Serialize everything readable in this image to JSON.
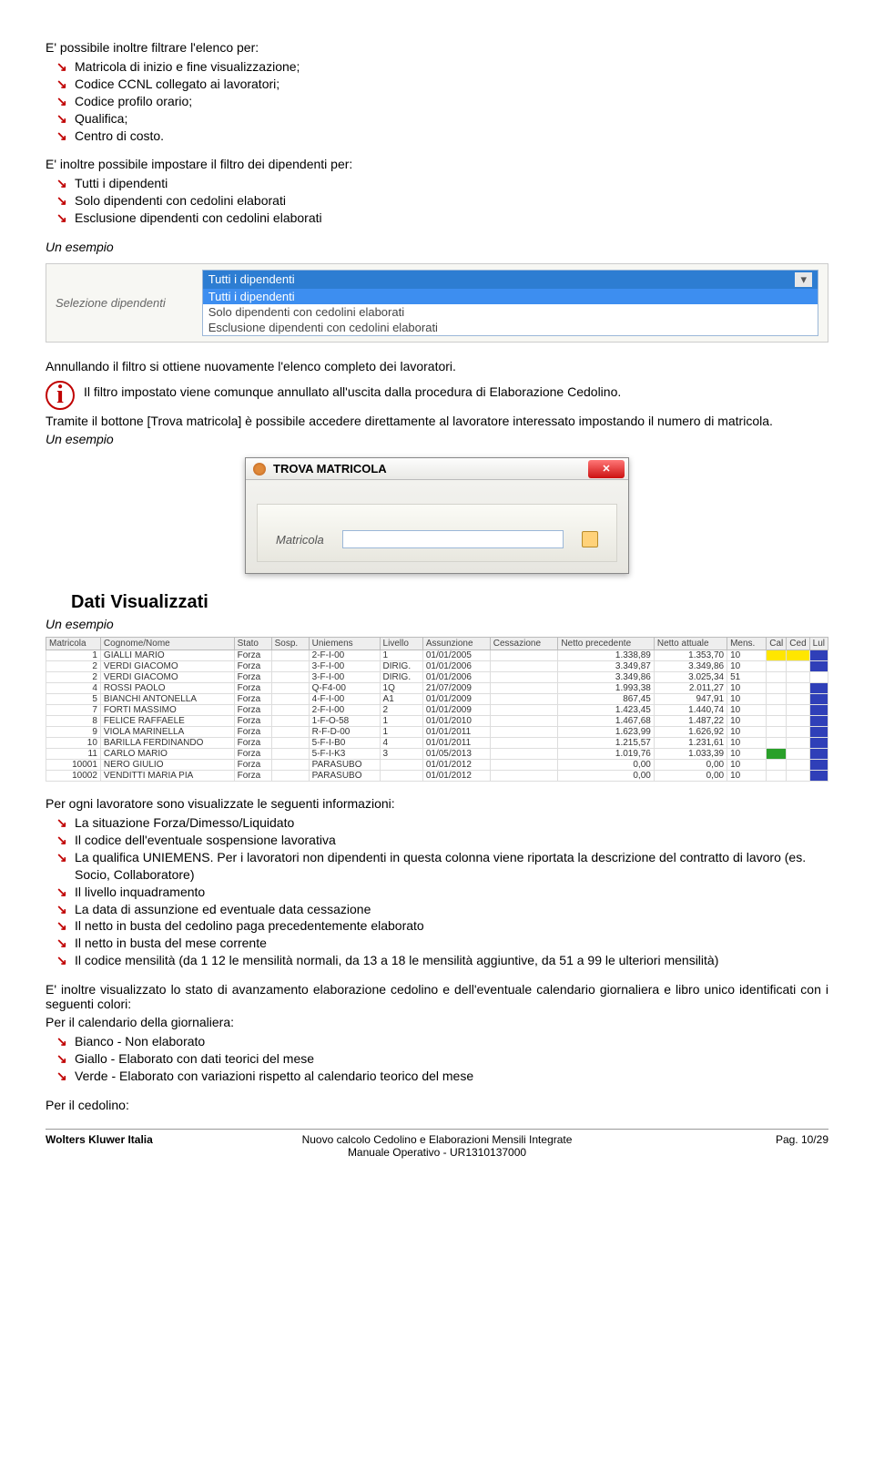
{
  "intro_line": "E' possibile inoltre filtrare l'elenco per:",
  "filters1": [
    "Matricola di inizio e fine visualizzazione;",
    "Codice CCNL collegato ai lavoratori;",
    "Codice profilo orario;",
    "Qualifica;",
    "Centro di costo."
  ],
  "intro_line2": "E' inoltre possibile impostare il filtro dei dipendenti per:",
  "filters2": [
    "Tutti i dipendenti",
    "Solo dipendenti con cedolini elaborati",
    "Esclusione dipendenti con cedolini elaborati"
  ],
  "un_esempio": "Un esempio",
  "dropdown": {
    "label": "Selezione dipendenti",
    "selected": "Tutti i dipendenti",
    "options": [
      "Tutti i dipendenti",
      "Solo dipendenti con cedolini elaborati",
      "Esclusione dipendenti con cedolini elaborati"
    ]
  },
  "annullando": "Annullando il filtro si ottiene nuovamente l'elenco completo dei lavoratori.",
  "info_text": "Il filtro impostato viene comunque annullato all'uscita dalla procedura di Elaborazione Cedolino.",
  "tramite": "Tramite il bottone [Trova matricola] è possibile accedere direttamente al lavoratore interessato impostando il numero di matricola.",
  "trova": {
    "title": "TROVA MATRICOLA",
    "label": "Matricola"
  },
  "dati_heading": "Dati Visualizzati",
  "table": {
    "headers": [
      "Matricola",
      "Cognome/Nome",
      "Stato",
      "Sosp.",
      "Uniemens",
      "Livello",
      "Assunzione",
      "Cessazione",
      "Netto precedente",
      "Netto attuale",
      "Mens.",
      "Cal",
      "Ced",
      "Lul"
    ],
    "rows": [
      {
        "id": "1",
        "name": "GIALLI MARIO",
        "stato": "Forza",
        "sosp": "",
        "uni": "2-F-I-00",
        "liv": "1",
        "ass": "01/01/2005",
        "cess": "",
        "np": "1.338,89",
        "na": "1.353,70",
        "mens": "10",
        "cal": "yellow",
        "ced": "yellow",
        "lul": "blue"
      },
      {
        "id": "2",
        "name": "VERDI GIACOMO",
        "stato": "Forza",
        "sosp": "",
        "uni": "3-F-I-00",
        "liv": "DIRIG.",
        "ass": "01/01/2006",
        "cess": "",
        "np": "3.349,87",
        "na": "3.349,86",
        "mens": "10",
        "cal": "",
        "ced": "",
        "lul": "blue"
      },
      {
        "id": "2",
        "name": "VERDI GIACOMO",
        "stato": "Forza",
        "sosp": "",
        "uni": "3-F-I-00",
        "liv": "DIRIG.",
        "ass": "01/01/2006",
        "cess": "",
        "np": "3.349,86",
        "na": "3.025,34",
        "mens": "51",
        "cal": "",
        "ced": "",
        "lul": ""
      },
      {
        "id": "4",
        "name": "ROSSI PAOLO",
        "stato": "Forza",
        "sosp": "",
        "uni": "Q-F4-00",
        "liv": "1Q",
        "ass": "21/07/2009",
        "cess": "",
        "np": "1.993,38",
        "na": "2.011,27",
        "mens": "10",
        "cal": "",
        "ced": "",
        "lul": "blue"
      },
      {
        "id": "5",
        "name": "BIANCHI ANTONELLA",
        "stato": "Forza",
        "sosp": "",
        "uni": "4-F-I-00",
        "liv": "A1",
        "ass": "01/01/2009",
        "cess": "",
        "np": "867,45",
        "na": "947,91",
        "mens": "10",
        "cal": "",
        "ced": "",
        "lul": "blue"
      },
      {
        "id": "7",
        "name": "FORTI MASSIMO",
        "stato": "Forza",
        "sosp": "",
        "uni": "2-F-I-00",
        "liv": "2",
        "ass": "01/01/2009",
        "cess": "",
        "np": "1.423,45",
        "na": "1.440,74",
        "mens": "10",
        "cal": "",
        "ced": "",
        "lul": "blue"
      },
      {
        "id": "8",
        "name": "FELICE RAFFAELE",
        "stato": "Forza",
        "sosp": "",
        "uni": "1-F-O-58",
        "liv": "1",
        "ass": "01/01/2010",
        "cess": "",
        "np": "1.467,68",
        "na": "1.487,22",
        "mens": "10",
        "cal": "",
        "ced": "",
        "lul": "blue"
      },
      {
        "id": "9",
        "name": "VIOLA MARINELLA",
        "stato": "Forza",
        "sosp": "",
        "uni": "R-F-D-00",
        "liv": "1",
        "ass": "01/01/2011",
        "cess": "",
        "np": "1.623,99",
        "na": "1.626,92",
        "mens": "10",
        "cal": "",
        "ced": "",
        "lul": "blue"
      },
      {
        "id": "10",
        "name": "BARILLA FERDINANDO",
        "stato": "Forza",
        "sosp": "",
        "uni": "5-F-I-B0",
        "liv": "4",
        "ass": "01/01/2011",
        "cess": "",
        "np": "1.215,57",
        "na": "1.231,61",
        "mens": "10",
        "cal": "",
        "ced": "",
        "lul": "blue"
      },
      {
        "id": "11",
        "name": "CARLO MARIO",
        "stato": "Forza",
        "sosp": "",
        "uni": "5-F-I-K3",
        "liv": "3",
        "ass": "01/05/2013",
        "cess": "",
        "np": "1.019,76",
        "na": "1.033,39",
        "mens": "10",
        "cal": "green",
        "ced": "",
        "lul": "blue"
      },
      {
        "id": "10001",
        "name": "NERO GIULIO",
        "stato": "Forza",
        "sosp": "",
        "uni": "PARASUBO",
        "liv": "",
        "ass": "01/01/2012",
        "cess": "",
        "np": "0,00",
        "na": "0,00",
        "mens": "10",
        "cal": "",
        "ced": "",
        "lul": "blue"
      },
      {
        "id": "10002",
        "name": "VENDITTI MARIA PIA",
        "stato": "Forza",
        "sosp": "",
        "uni": "PARASUBO",
        "liv": "",
        "ass": "01/01/2012",
        "cess": "",
        "np": "0,00",
        "na": "0,00",
        "mens": "10",
        "cal": "",
        "ced": "",
        "lul": "blue"
      }
    ]
  },
  "perogni": "Per ogni lavoratore sono visualizzate le seguenti informazioni:",
  "infolist": [
    "La situazione Forza/Dimesso/Liquidato",
    "Il codice dell'eventuale sospensione lavorativa",
    "La qualifica UNIEMENS. Per i lavoratori non dipendenti in questa colonna viene riportata la descrizione del contratto di lavoro (es. Socio, Collaboratore)",
    "Il livello inquadramento",
    "La data di assunzione ed eventuale data cessazione",
    "Il netto in busta del cedolino paga precedentemente elaborato",
    "Il netto in busta del mese corrente",
    "Il codice mensilità (da 1 12 le mensilità normali, da 13 a 18 le mensilità aggiuntive, da 51 a 99 le ulteriori mensilità)"
  ],
  "einoltre": "E' inoltre visualizzato lo stato di avanzamento elaborazione cedolino e dell'eventuale calendario giornaliera e libro unico identificati con i seguenti colori:",
  "cal_heading": "Per il calendario della giornaliera:",
  "cal_list": [
    "Bianco - Non elaborato",
    "Giallo - Elaborato con dati teorici del mese",
    "Verde - Elaborato con variazioni rispetto al calendario teorico del mese"
  ],
  "ced_heading": "Per il cedolino:",
  "footer": {
    "left": "Wolters Kluwer Italia",
    "center1": "Nuovo calcolo Cedolino e Elaborazioni Mensili Integrate",
    "center2": "Manuale Operativo - UR1310137000",
    "right": "Pag.  10/29"
  }
}
